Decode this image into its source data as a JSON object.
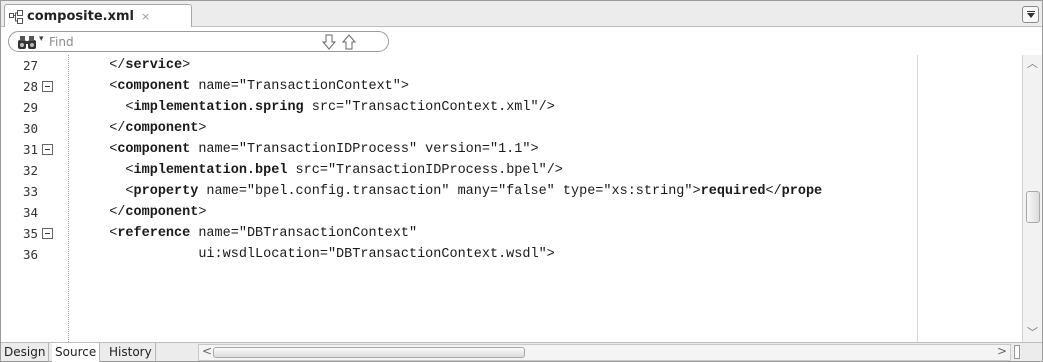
{
  "tab": {
    "title": "composite.xml",
    "close": "×",
    "menu_icon": "dropdown-arrow-icon"
  },
  "find": {
    "placeholder": "Find",
    "dropdown": "▾"
  },
  "editor": {
    "lines": [
      {
        "number": "27",
        "indent": "  ",
        "parts": [
          {
            "t": "</",
            "b": false
          },
          {
            "t": "service",
            "b": true
          },
          {
            "t": ">",
            "b": false
          }
        ]
      },
      {
        "number": "28",
        "indent": "  ",
        "fold": true,
        "parts": [
          {
            "t": "<",
            "b": false
          },
          {
            "t": "component",
            "b": true
          },
          {
            "t": " name=\"TransactionContext\">",
            "b": false
          }
        ]
      },
      {
        "number": "29",
        "indent": "    ",
        "parts": [
          {
            "t": "<",
            "b": false
          },
          {
            "t": "implementation.spring",
            "b": true
          },
          {
            "t": " src=\"TransactionContext.xml\"/>",
            "b": false
          }
        ]
      },
      {
        "number": "30",
        "indent": "  ",
        "parts": [
          {
            "t": "</",
            "b": false
          },
          {
            "t": "component",
            "b": true
          },
          {
            "t": ">",
            "b": false
          }
        ]
      },
      {
        "number": "31",
        "indent": "  ",
        "fold": true,
        "parts": [
          {
            "t": "<",
            "b": false
          },
          {
            "t": "component",
            "b": true
          },
          {
            "t": " name=\"TransactionIDProcess\" version=\"1.1\">",
            "b": false
          }
        ]
      },
      {
        "number": "32",
        "indent": "    ",
        "parts": [
          {
            "t": "<",
            "b": false
          },
          {
            "t": "implementation.bpel",
            "b": true
          },
          {
            "t": " src=\"TransactionIDProcess.bpel\"/>",
            "b": false
          }
        ]
      },
      {
        "number": "33",
        "indent": "    ",
        "parts": [
          {
            "t": "<",
            "b": false
          },
          {
            "t": "property",
            "b": true
          },
          {
            "t": " name=\"bpel.config.transaction\" many=\"false\" type=\"xs:string\">",
            "b": false
          },
          {
            "t": "required",
            "b": true
          },
          {
            "t": "</",
            "b": false
          },
          {
            "t": "prope",
            "b": true
          }
        ]
      },
      {
        "number": "34",
        "indent": "  ",
        "parts": [
          {
            "t": "</",
            "b": false
          },
          {
            "t": "component",
            "b": true
          },
          {
            "t": ">",
            "b": false
          }
        ]
      },
      {
        "number": "35",
        "indent": "  ",
        "fold": true,
        "parts": [
          {
            "t": "<",
            "b": false
          },
          {
            "t": "reference",
            "b": true
          },
          {
            "t": " name=\"DBTransactionContext\"",
            "b": false
          }
        ]
      },
      {
        "number": "36",
        "indent": "             ",
        "parts": [
          {
            "t": "ui:wsdlLocation=\"DBTransactionContext.wsdl\">",
            "b": false
          }
        ]
      }
    ]
  },
  "scroll": {
    "vertical_position": 0.55,
    "horizontal_position": 0.0,
    "horizontal_extent": 0.4
  },
  "bottom_tabs": [
    {
      "label": "Design",
      "active": false
    },
    {
      "label": "Source",
      "active": true
    },
    {
      "label": "History",
      "active": false
    }
  ]
}
